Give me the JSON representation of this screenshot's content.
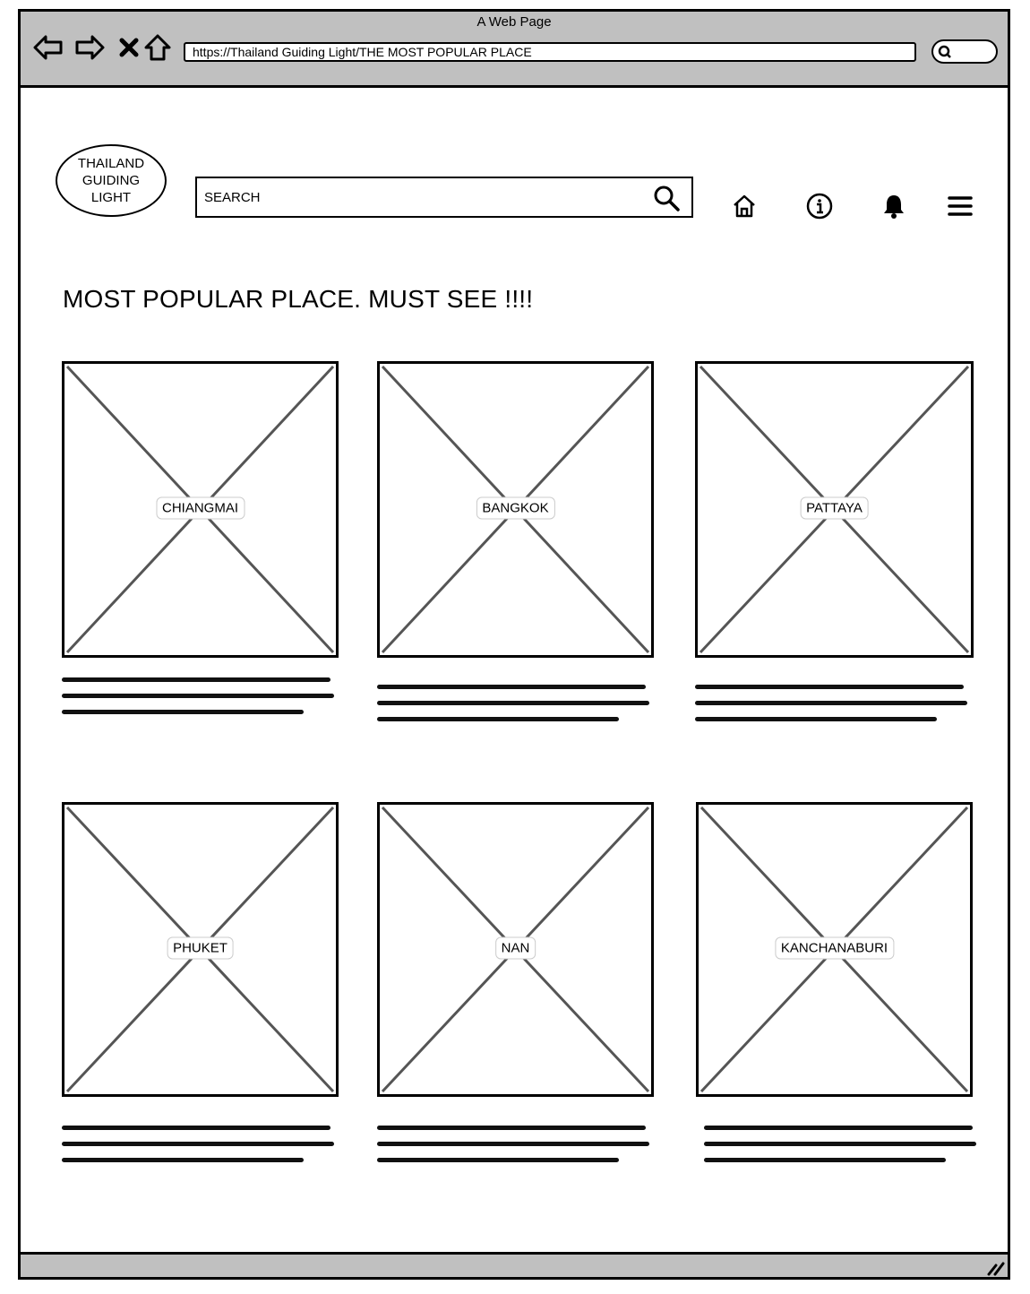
{
  "browser": {
    "window_title": "A Web Page",
    "url": "https://Thailand Guiding Light/THE MOST POPULAR PLACE"
  },
  "header": {
    "logo_text": "THAILAND\nGUIDING\nLIGHT",
    "search_placeholder": "SEARCH",
    "icons": [
      "home-icon",
      "info-icon",
      "bell-icon",
      "menu-icon"
    ]
  },
  "main": {
    "title": "MOST POPULAR PLACE.  MUST SEE !!!!",
    "cards": [
      {
        "label": "CHIANGMAI"
      },
      {
        "label": "BANGKOK"
      },
      {
        "label": "PATTAYA"
      },
      {
        "label": "PHUKET"
      },
      {
        "label": "NAN"
      },
      {
        "label": "KANCHANABURI"
      }
    ]
  }
}
